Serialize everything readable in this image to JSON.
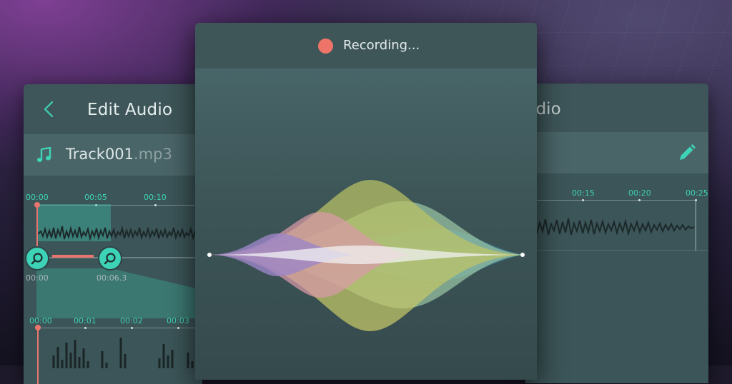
{
  "left_panel": {
    "title": "Edit Audio",
    "track": {
      "name": "Track001",
      "ext": ".mp3"
    },
    "top_ruler_ticks": [
      "00:00",
      "00:05",
      "00:10"
    ],
    "selection_start": "00:00",
    "selection_end": "00:06.3",
    "bottom_ruler_ticks": [
      "00:00",
      "00:01",
      "00:02",
      "00:03"
    ]
  },
  "center_panel": {
    "status": "Recording..."
  },
  "right_panel": {
    "title_fragment": "udio",
    "ruler_ticks": [
      "00:15",
      "00:20",
      "00:25"
    ]
  },
  "colors": {
    "accent": "#3dd3b6",
    "record": "#ee7469",
    "playhead": "#e8766e",
    "panel": "#3c5558"
  },
  "icons": {
    "back": "chevron-left-icon",
    "music": "music-note-icon",
    "zoom": "magnifier-icon",
    "edit": "pencil-icon"
  }
}
